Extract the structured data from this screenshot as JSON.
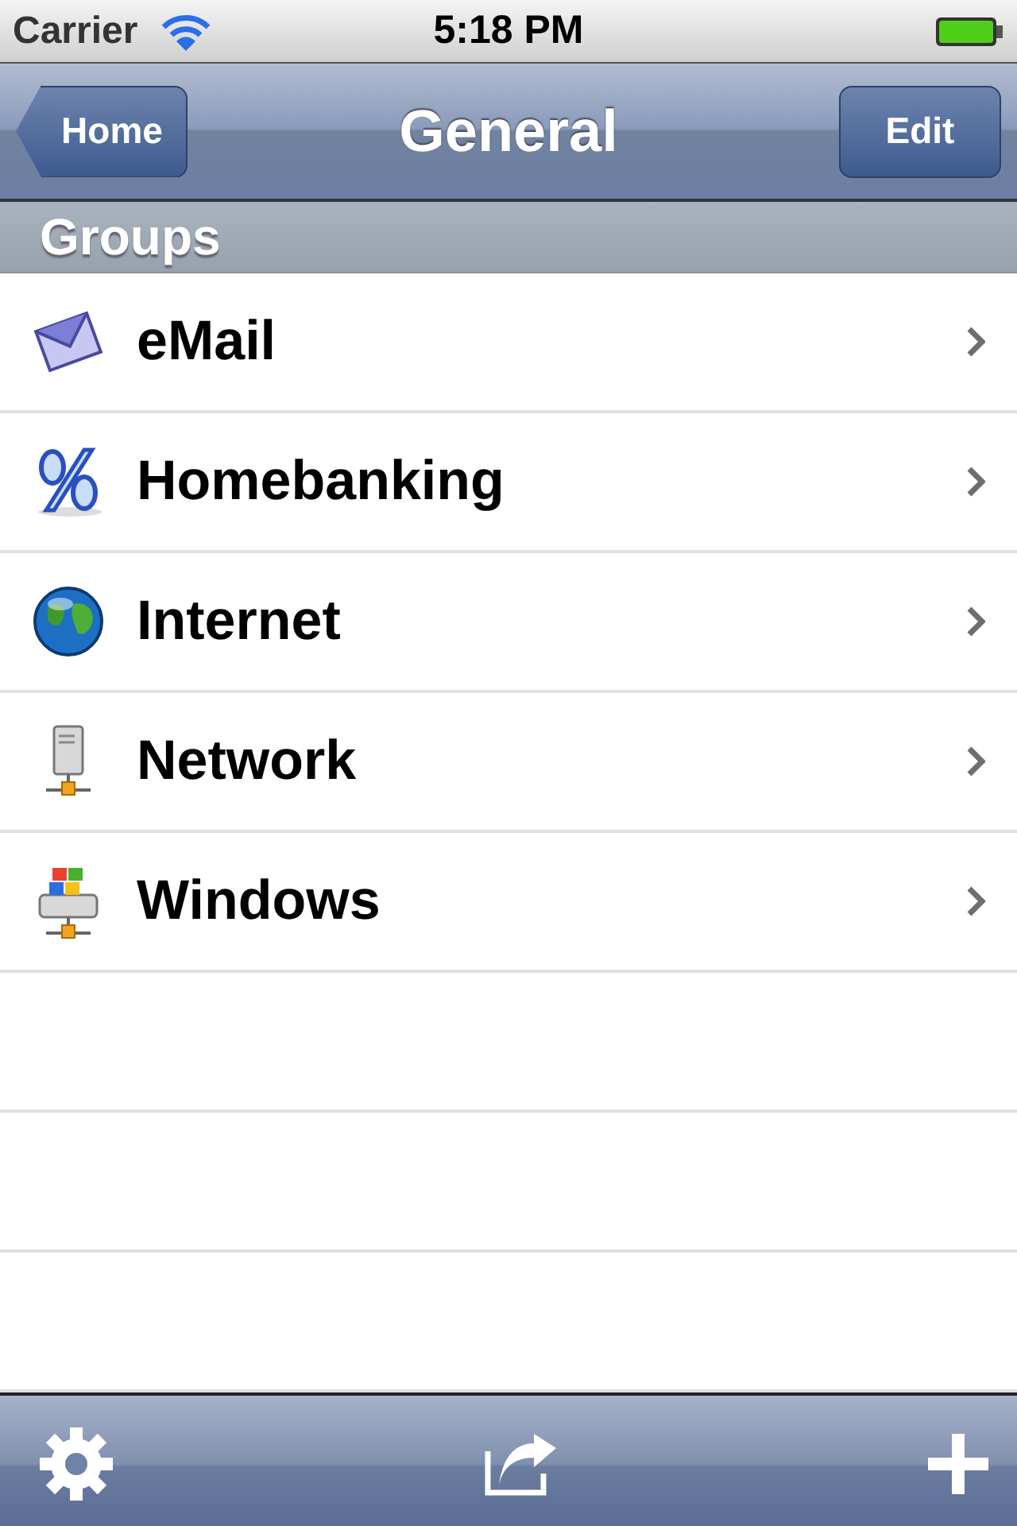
{
  "status_bar": {
    "carrier": "Carrier",
    "time": "5:18 PM"
  },
  "nav": {
    "back": "Home",
    "title": "General",
    "action": "Edit"
  },
  "section": "Groups",
  "rows": [
    {
      "label": "eMail",
      "kind": "envelope"
    },
    {
      "label": "Homebanking",
      "kind": "percent"
    },
    {
      "label": "Internet",
      "kind": "globe"
    },
    {
      "label": "Network",
      "kind": "server"
    },
    {
      "label": "Windows",
      "kind": "windows"
    }
  ],
  "toolbar": {
    "items": [
      {
        "kind": "settings"
      },
      {
        "kind": "share"
      },
      {
        "kind": "add"
      }
    ]
  }
}
